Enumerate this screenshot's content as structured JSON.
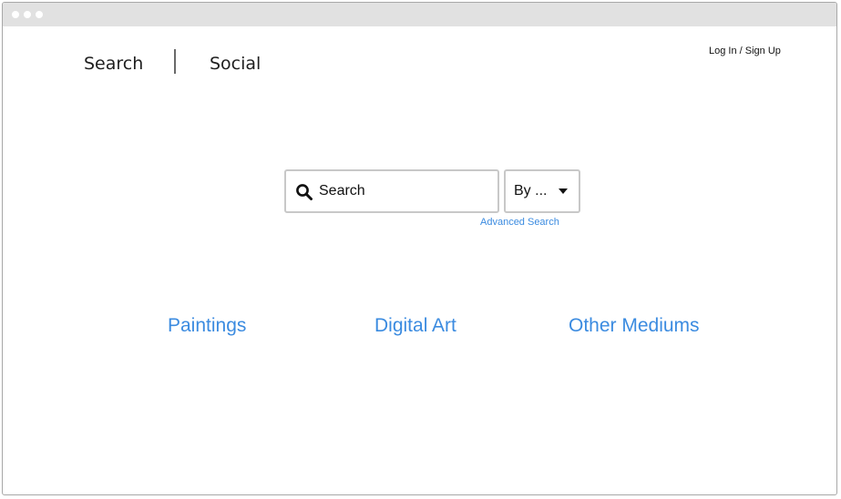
{
  "nav": {
    "search_label": "Search",
    "social_label": "Social"
  },
  "account": {
    "login_label": "Log In / Sign Up"
  },
  "search": {
    "placeholder": "Search",
    "icon": "search-icon",
    "filter_label": "By ...",
    "filter_icon": "caret-down-icon",
    "advanced_label": "Advanced Search"
  },
  "categories": [
    {
      "label": "Paintings"
    },
    {
      "label": "Digital Art"
    },
    {
      "label": "Other Mediums"
    }
  ],
  "colors": {
    "accent": "#3b8be0",
    "titlebar": "#e1e1e1",
    "border": "#c8c8c8",
    "text": "#111111"
  }
}
